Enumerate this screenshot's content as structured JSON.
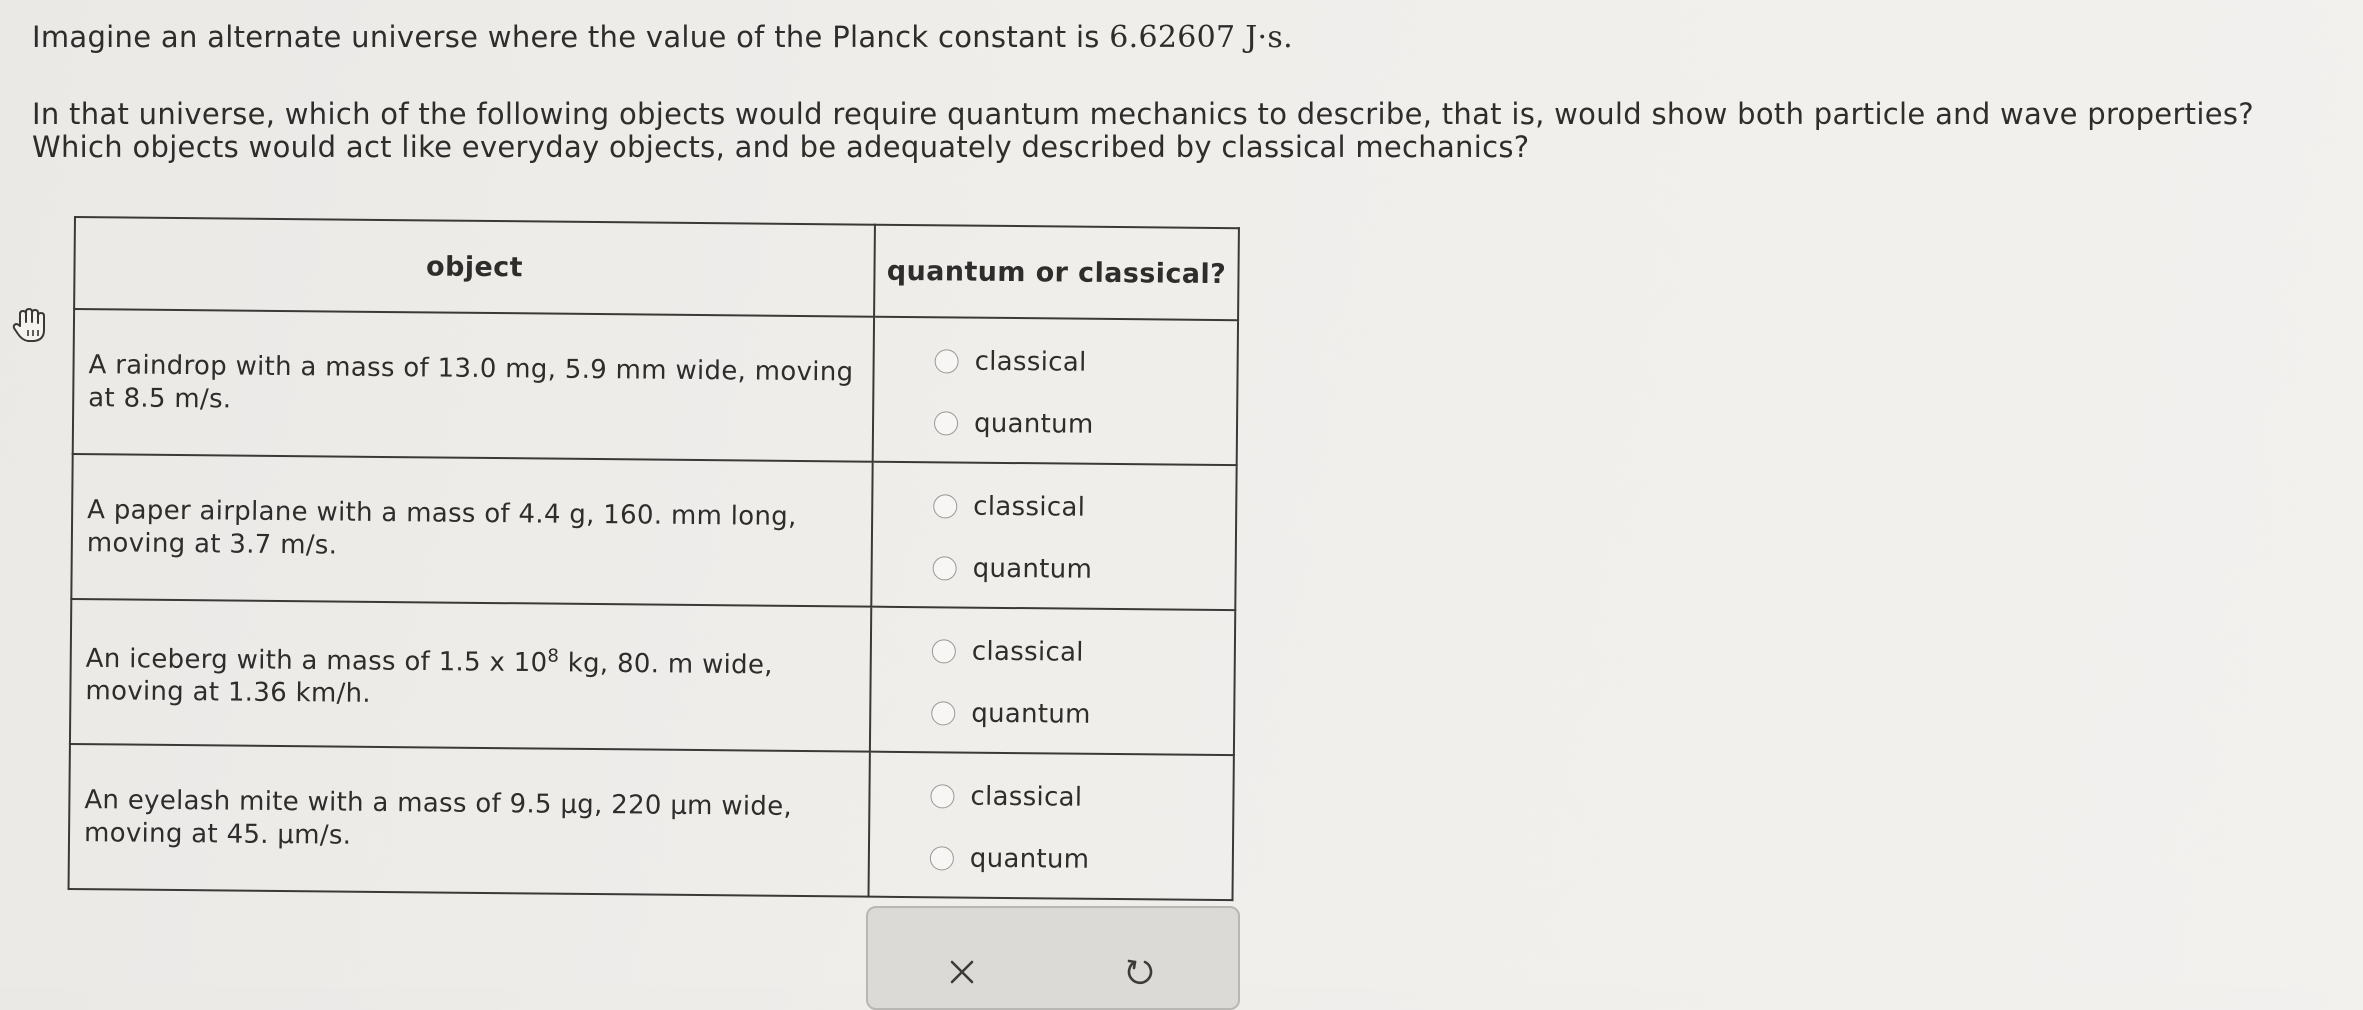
{
  "intro": {
    "text_prefix": "Imagine an alternate universe where the value of the Planck constant is ",
    "constant_value": "6.62607 J·s."
  },
  "question": "In that universe, which of the following objects would require quantum mechanics to describe, that is, would show both particle and wave properties? Which objects would act like everyday objects, and be adequately described by classical mechanics?",
  "table": {
    "headers": [
      "object",
      "quantum or classical?"
    ],
    "rows": [
      {
        "object": "A raindrop with a mass of 13.0 mg, 5.9 mm wide, moving at 8.5 m/s.",
        "options": [
          "classical",
          "quantum"
        ]
      },
      {
        "object": "A paper airplane with a mass of 4.4 g, 160. mm long, moving at 3.7 m/s.",
        "options": [
          "classical",
          "quantum"
        ]
      },
      {
        "object_before_exp": "An iceberg with a mass of 1.5 x 10",
        "object_exp": "8",
        "object_after_exp": " kg, 80. m wide, moving at 1.36 km/h.",
        "options": [
          "classical",
          "quantum"
        ]
      },
      {
        "object": "An eyelash mite with a mass of 9.5 μg, 220 μm wide, moving at 45. μm/s.",
        "options": [
          "classical",
          "quantum"
        ]
      }
    ]
  },
  "actions": {
    "clear_icon": "x-icon",
    "reset_icon": "undo-icon"
  }
}
